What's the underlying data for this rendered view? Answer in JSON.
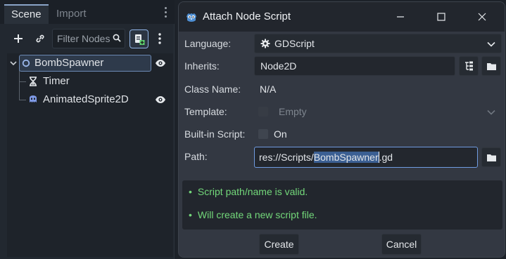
{
  "scene_dock": {
    "tabs": [
      {
        "label": "Scene"
      },
      {
        "label": "Import"
      }
    ],
    "filter_placeholder": "Filter Nodes",
    "toolbar_icons": [
      "add-icon",
      "link-icon",
      "search-icon",
      "attach-script-icon",
      "more-icon"
    ],
    "tree": [
      {
        "label": "BombSpawner",
        "icon": "node2d-icon",
        "selected": true,
        "visible": true
      },
      {
        "label": "Timer",
        "icon": "hourglass-icon",
        "selected": false,
        "visible": false
      },
      {
        "label": "AnimatedSprite2D",
        "icon": "sprite-icon",
        "selected": false,
        "visible": true
      }
    ]
  },
  "dialog": {
    "title": "Attach Node Script",
    "labels": {
      "language": "Language:",
      "inherits": "Inherits:",
      "class_name": "Class Name:",
      "template": "Template:",
      "builtin": "Built-in Script:",
      "path": "Path:"
    },
    "language_value": "GDScript",
    "inherits_value": "Node2D",
    "class_name_value": "N/A",
    "template_value": "Empty",
    "builtin_value": "On",
    "path": {
      "prefix": "res://Scripts/",
      "selected": "BombSpawner",
      "suffix": ".gd"
    },
    "status": [
      {
        "bullet": "•",
        "text": "Script path/name is valid."
      },
      {
        "bullet": "•",
        "text": "Will create a new script file."
      }
    ],
    "create_label": "Create",
    "cancel_label": "Cancel",
    "colors": {
      "accent": "#6f9be0",
      "status_ok": "#73d87a",
      "selection": "#3b5f93"
    }
  }
}
